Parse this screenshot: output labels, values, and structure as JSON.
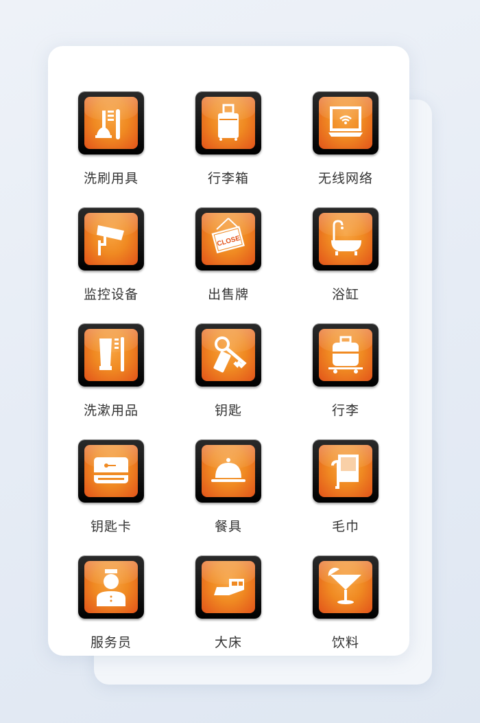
{
  "colors": {
    "frame": "#000000",
    "orange": "#f08a22",
    "red_edge": "#e2531a",
    "glyph": "#ffffff"
  },
  "items": [
    {
      "label": "洗刷用具",
      "icon": "plunger-brush-icon"
    },
    {
      "label": "行李箱",
      "icon": "suitcase-icon"
    },
    {
      "label": "无线网络",
      "icon": "wifi-laptop-icon"
    },
    {
      "label": "监控设备",
      "icon": "cctv-camera-icon"
    },
    {
      "label": "出售牌",
      "icon": "close-sign-icon",
      "sign_text": "CLOSE"
    },
    {
      "label": "浴缸",
      "icon": "bathtub-icon"
    },
    {
      "label": "洗漱用品",
      "icon": "toothpaste-brush-icon"
    },
    {
      "label": "钥匙",
      "icon": "key-tag-icon"
    },
    {
      "label": "行李",
      "icon": "luggage-cart-icon"
    },
    {
      "label": "钥匙卡",
      "icon": "key-card-icon"
    },
    {
      "label": "餐具",
      "icon": "cloche-icon"
    },
    {
      "label": "毛巾",
      "icon": "towel-icon"
    },
    {
      "label": "服务员",
      "icon": "bellboy-icon"
    },
    {
      "label": "大床",
      "icon": "bed-icon"
    },
    {
      "label": "饮料",
      "icon": "cocktail-icon"
    }
  ]
}
